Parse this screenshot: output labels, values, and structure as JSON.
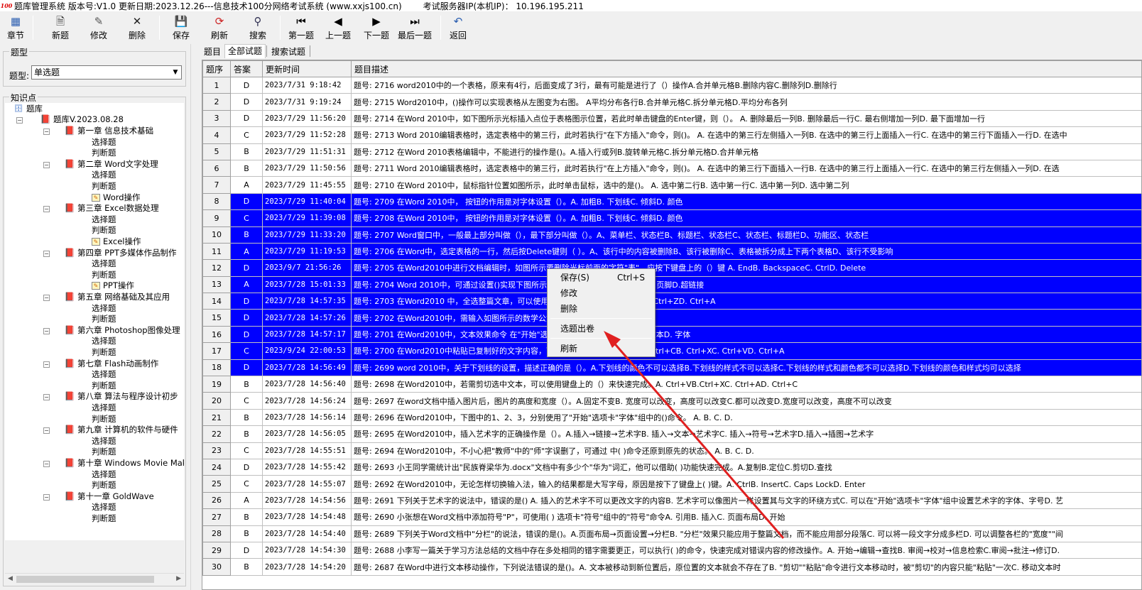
{
  "window": {
    "title": "题库管理系统 版本号:V1.0 更新日期:2023.12.26---信息技术100分网络考试系统   (www.xxjs100.cn)",
    "server_label": "考试服务器IP(本机IP)： 10.196.195.211"
  },
  "toolbar": [
    {
      "label": "章节",
      "icon": "chapter-icon"
    },
    {
      "label": "新题",
      "icon": "new-icon"
    },
    {
      "label": "修改",
      "icon": "edit-icon"
    },
    {
      "label": "删除",
      "icon": "delete-icon"
    },
    {
      "label": "保存",
      "icon": "save-icon"
    },
    {
      "label": "刷新",
      "icon": "refresh-icon"
    },
    {
      "label": "搜索",
      "icon": "search-icon"
    },
    {
      "label": "第一题",
      "icon": "first-icon"
    },
    {
      "label": "上一题",
      "icon": "prev-icon"
    },
    {
      "label": "下一题",
      "icon": "next-icon"
    },
    {
      "label": "最后一题",
      "icon": "last-icon"
    },
    {
      "label": "返回",
      "icon": "back-icon"
    }
  ],
  "filter": {
    "group_label": "题型",
    "type_label": "题型:",
    "type_value": "单选题"
  },
  "knowledge": {
    "group_label": "知识点",
    "root": "题库",
    "bank": "题库V.2023.08.28",
    "chapters": [
      {
        "label": "第一章 信息技术基础",
        "children": [
          "选择题",
          "判断题"
        ]
      },
      {
        "label": "第二章 Word文字处理",
        "children": [
          "选择题",
          "判断题",
          "Word操作"
        ]
      },
      {
        "label": "第三章 Excel数据处理",
        "children": [
          "选择题",
          "判断题",
          "Excel操作"
        ]
      },
      {
        "label": "第四章 PPT多媒体作品制作",
        "children": [
          "选择题",
          "判断题",
          "PPT操作"
        ]
      },
      {
        "label": "第五章 网络基础及其应用",
        "children": [
          "选择题",
          "判断题"
        ]
      },
      {
        "label": "第六章 Photoshop图像处理",
        "children": [
          "选择题",
          "判断题"
        ]
      },
      {
        "label": "第七章 Flash动画制作",
        "children": [
          "选择题",
          "判断题"
        ]
      },
      {
        "label": "第八章 算法与程序设计初步",
        "children": [
          "选择题",
          "判断题"
        ]
      },
      {
        "label": "第九章 计算机的软件与硬件",
        "children": [
          "选择题",
          "判断题"
        ]
      },
      {
        "label": "第十章 Windows Movie Make",
        "children": [
          "选择题",
          "判断题"
        ]
      },
      {
        "label": "第十一章 GoldWave",
        "children": [
          "选择题",
          "判断题"
        ]
      }
    ]
  },
  "tabs": [
    "题目",
    "全部试题",
    "搜索试题"
  ],
  "grid": {
    "columns": [
      "题序",
      "答案",
      "更新时间",
      "题目描述"
    ],
    "rows": [
      {
        "n": "1",
        "a": "D",
        "t": "2023/7/31 9:18:42",
        "d": "题号: 2716 word2010中的一个表格，原来有4行，后面变成了3行，最有可能是进行了（）操作A.合并单元格B.删除内容C.删除列D.删除行",
        "sel": false
      },
      {
        "n": "2",
        "a": "D",
        "t": "2023/7/31 9:19:24",
        "d": "题号: 2715 Word2010中，()操作可以实现表格从左图变为右图。 A平均分布各行B.合并单元格C.拆分单元格D.平均分布各列",
        "sel": false
      },
      {
        "n": "3",
        "a": "D",
        "t": "2023/7/29 11:56:20",
        "d": "题号: 2714 在Word 2010中，如下图所示光标插入点位于表格图示位置，若此时单击键盘的Enter键，则（）。 A. 删除最后一列B. 删除最后一行C. 最右侧增加一列D. 最下面增加一行",
        "sel": false
      },
      {
        "n": "4",
        "a": "C",
        "t": "2023/7/29 11:52:28",
        "d": "题号: 2713 Word 2010编辑表格时，选定表格中的第三行，此时若执行\"在下方插入\"命令，则()。 A. 在选中的第三行左侧插入一列B. 在选中的第三行上面插入一行C. 在选中的第三行下面插入一行D. 在选中",
        "sel": false
      },
      {
        "n": "5",
        "a": "B",
        "t": "2023/7/29 11:51:31",
        "d": "题号: 2712 在Word 2010表格编辑中，不能进行的操作是()。A.插入行或列B.旋转单元格C.拆分单元格D.合并单元格",
        "sel": false
      },
      {
        "n": "6",
        "a": "B",
        "t": "2023/7/29 11:50:56",
        "d": "题号: 2711 Word 2010编辑表格时，选定表格中的第三行，此时若执行\"在上方插入\"命令，则()。 A. 在选中的第三行下面插入一行B. 在选中的第三行上面插入一行C. 在选中的第三行左侧插入一列D. 在选",
        "sel": false
      },
      {
        "n": "7",
        "a": "A",
        "t": "2023/7/29 11:45:55",
        "d": "题号: 2710 在Word 2010中，鼠标指针位置如图所示，此时单击鼠标，选中的是()。  A. 选中第二行B. 选中第一行C. 选中第一列D. 选中第二列",
        "sel": false
      },
      {
        "n": "8",
        "a": "D",
        "t": "2023/7/29 11:40:04",
        "d": "题号: 2709 在Word 2010中，  按钮的作用是对字体设置（）。A. 加粗B. 下划线C. 倾斜D. 颜色",
        "sel": true
      },
      {
        "n": "9",
        "a": "C",
        "t": "2023/7/29 11:39:08",
        "d": "题号: 2708 在Word 2010中，  按钮的作用是对字体设置（）。A. 加粗B. 下划线C. 倾斜D. 颜色",
        "sel": true
      },
      {
        "n": "10",
        "a": "B",
        "t": "2023/7/29 11:33:20",
        "d": "题号: 2707 Word窗口中，一般最上部分叫做（），最下部分叫做（）。A、菜单栏、状态栏B、标题栏、状态栏C、状态栏、标题栏D、功能区、状态栏",
        "sel": true
      },
      {
        "n": "11",
        "a": "A",
        "t": "2023/7/29 11:19:53",
        "d": "题号: 2706 在Word中，选定表格的一行，然后按Delete键则（    ）。A、该行中的内容被删除B、该行被删除C、表格被拆分成上下两个表格D、该行不受影响",
        "sel": true
      },
      {
        "n": "12",
        "a": "D",
        "t": "2023/9/7 21:56:26",
        "d": "题号: 2705 在Word2010中进行文档编辑时，如图所示要删除光标前面的字符\"表\"，应按下键盘上的（）键 A. EndB. BackspaceC. CtrlD. Delete",
        "sel": true
      },
      {
        "n": "13",
        "a": "A",
        "t": "2023/7/28 15:01:33",
        "d": "题号: 2704 Word 2010中，可通过设置()实现下图所示效果。A.页眉B.页码C.页边距C.页脚D.超链接",
        "sel": true
      },
      {
        "n": "14",
        "a": "D",
        "t": "2023/7/28 14:57:35",
        "d": "题号: 2703 在Word2010 中，全选整篇文章，可以使用键盘快捷键（）。A. Ctrl+XC. Ctrl+ZD. Ctrl+A",
        "sel": true
      },
      {
        "n": "15",
        "a": "D",
        "t": "2023/7/28 14:57:26",
        "d": "题号: 2702 在Word2010中，需输入如图所示的数学公式，应使用（）。A.  B.  C.  D.",
        "sel": true
      },
      {
        "n": "16",
        "a": "D",
        "t": "2023/7/28 14:57:17",
        "d": "题号: 2701 在Word2010中，文本效果命令 在\"开始\"选项卡的哪个组中（）。样式C. 文本D. 字体",
        "sel": true
      },
      {
        "n": "17",
        "a": "C",
        "t": "2023/9/24 22:00:53",
        "d": "题号: 2700 在Word2010中粘贴已复制好的文字内容，可以使用快捷键（）完成。A. Ctrl+CB. Ctrl+XC. Ctrl+VD. Ctrl+A",
        "sel": true
      },
      {
        "n": "18",
        "a": "D",
        "t": "2023/7/28 14:56:49",
        "d": "题号: 2699 word 2010中，关于下划线的设置，描述正确的是（）。A.下划线的颜色不可以选择B.下划线的样式不可以选择C.下划线的样式和颜色都不可以选择D.下划线的颜色和样式均可以选择",
        "sel": true
      },
      {
        "n": "19",
        "a": "B",
        "t": "2023/7/28 14:56:40",
        "d": "题号: 2698 在Word2010中，若需剪切选中文本，可以使用键盘上的（）来快速完成。A. Ctrl+VB.Ctrl+XC. Ctrl+AD. Ctrl+C",
        "sel": false
      },
      {
        "n": "20",
        "a": "C",
        "t": "2023/7/28 14:56:24",
        "d": "题号: 2697 在word文档中插入图片后，图片的高度和宽度（）。A.固定不变B. 宽度可以改变，高度可以改变C.都可以改变D.宽度可以改变，高度不可以改变",
        "sel": false
      },
      {
        "n": "21",
        "a": "B",
        "t": "2023/7/28 14:56:14",
        "d": "题号: 2696 在Word2010中，下图中的1、2、3，分别使用了\"开始\"选项卡\"字体\"组中的()命令。  A.     B.      C.      D.",
        "sel": false
      },
      {
        "n": "22",
        "a": "B",
        "t": "2023/7/28 14:56:05",
        "d": "题号: 2695 在Word2010中，插入艺术字的正确操作是（）。A.插入→链接→艺术字B. 插入→文本→艺术字C. 插入→符号→艺术字D.插入→插图→艺术字",
        "sel": false
      },
      {
        "n": "23",
        "a": "C",
        "t": "2023/7/28 14:55:51",
        "d": "题号: 2694 在Word2010中，不小心把\"教师\"中的\"师\"字误删了，可通过 中( )命令还原到原先的状态。 A.  B.  C.  D.",
        "sel": false
      },
      {
        "n": "24",
        "a": "D",
        "t": "2023/7/28 14:55:42",
        "d": "题号: 2693 小王同学需统计出\"民族脊梁华为.docx\"文档中有多少个\"华为\"词汇，他可以借助( )功能快速完成。A.复制B.定位C.剪切D.查找",
        "sel": false
      },
      {
        "n": "25",
        "a": "C",
        "t": "2023/7/28 14:55:07",
        "d": "题号: 2692 在Word2010中，无论怎样切换输入法，输入的结果都是大写字母，原因是按下了键盘上( )键。A. CtrlB. InsertC. Caps LockD. Enter",
        "sel": false
      },
      {
        "n": "26",
        "a": "A",
        "t": "2023/7/28 14:54:56",
        "d": "题号: 2691 下列关于艺术字的说法中，错误的是() A. 插入的艺术字不可以更改文字的内容B. 艺术字可以像图片一样设置其与文字的环绕方式C. 可以在\"开始\"选项卡\"字体\"组中设置艺术字的字体、字号D. 艺",
        "sel": false
      },
      {
        "n": "27",
        "a": "B",
        "t": "2023/7/28 14:54:48",
        "d": "题号: 2690 小张想在Word文档中添加符号\"P\"，可使用( ) 选项卡\"符号\"组中的\"符号\"命令A. 引用B. 插入C. 页面布局D. 开始",
        "sel": false
      },
      {
        "n": "28",
        "a": "B",
        "t": "2023/7/28 14:54:40",
        "d": "题号: 2689 下列关于Word文档中\"分栏\"的说法，错误的是()。A.页面布局→页面设置→分栏B. \"分栏\"效果只能应用于整篇文档，而不能应用部分段落C. 可以将一段文字分成多栏D. 可以调整各栏的\"宽度\"\"间",
        "sel": false
      },
      {
        "n": "29",
        "a": "D",
        "t": "2023/7/28 14:54:30",
        "d": "题号: 2688 小李写一篇关于学习方法总结的文档中存在多处相同的错字需要更正，可以执行( )的命令，快速完成对错误内容的修改操作。A. 开始→编辑→查找B. 审阅→校对→信息检索C.审阅→批注→修订D.",
        "sel": false
      },
      {
        "n": "30",
        "a": "B",
        "t": "2023/7/28 14:54:20",
        "d": "题号: 2687 在Word中进行文本移动操作，下列说法错误的是()。A. 文本被移动到新位置后，原位置的文本就会不存在了B. \"剪切\"\"粘贴\"命令进行文本移动时，被\"剪切\"的内容只能\"粘贴\"一次C. 移动文本时",
        "sel": false
      }
    ]
  },
  "context_menu": {
    "items": [
      {
        "label": "保存(S)",
        "shortcut": "Ctrl+S"
      },
      {
        "label": "修改",
        "shortcut": ""
      },
      {
        "label": "删除",
        "shortcut": ""
      },
      {
        "label": "选题出卷",
        "shortcut": ""
      },
      {
        "label": "刷新",
        "shortcut": ""
      }
    ]
  },
  "colors": {
    "selection": "#0000ff",
    "annotation_arrow": "#e02020"
  }
}
